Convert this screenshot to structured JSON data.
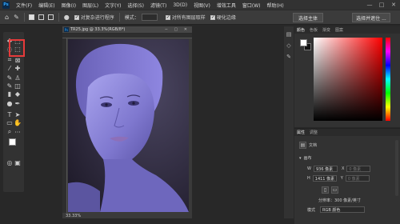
{
  "app": {
    "logo": "Ps"
  },
  "menu": [
    "文件(F)",
    "编辑(E)",
    "图像(I)",
    "图层(L)",
    "文字(Y)",
    "选择(S)",
    "滤镜(T)",
    "3D(D)",
    "视图(V)",
    "增效工具",
    "窗口(W)",
    "帮助(H)"
  ],
  "window_controls": {
    "minimize": "—",
    "maximize": "□",
    "close": "✕"
  },
  "options": {
    "auto_select_label": "对复杂进行程序",
    "mode_label": "模式：",
    "sample_all_label": "对所有图层取样",
    "enhance_edge_label": "硬化边缘",
    "select_subject": "选择主体",
    "select_and_mask": "选择并遮住 ..."
  },
  "document": {
    "tab_title": "TR25.jpg @ 33.3%(RGB/8*)",
    "tab_buttons": "− ▢ ✕",
    "status": "33.33%"
  },
  "color_panel": {
    "tabs": [
      "颜色",
      "色板",
      "渐变",
      "图案"
    ],
    "foreground": "#ffffff",
    "background": "#111111"
  },
  "properties_panel": {
    "tabs": [
      "属性",
      "调整"
    ],
    "doc_label": "文档",
    "canvas_label": "画布",
    "w_label": "W",
    "w_value": "936 像素",
    "x_label": "X",
    "x_placeholder": "0 像素",
    "h_label": "H",
    "h_value": "1411 像素",
    "y_label": "Y",
    "y_placeholder": "0 像素",
    "resolution": "分辨率：300 像素/英寸",
    "mode_label": "模式",
    "mode_value": "RGB 颜色"
  },
  "colors": {
    "highlight": "#e63a3a",
    "accent": "#31a8ff"
  }
}
